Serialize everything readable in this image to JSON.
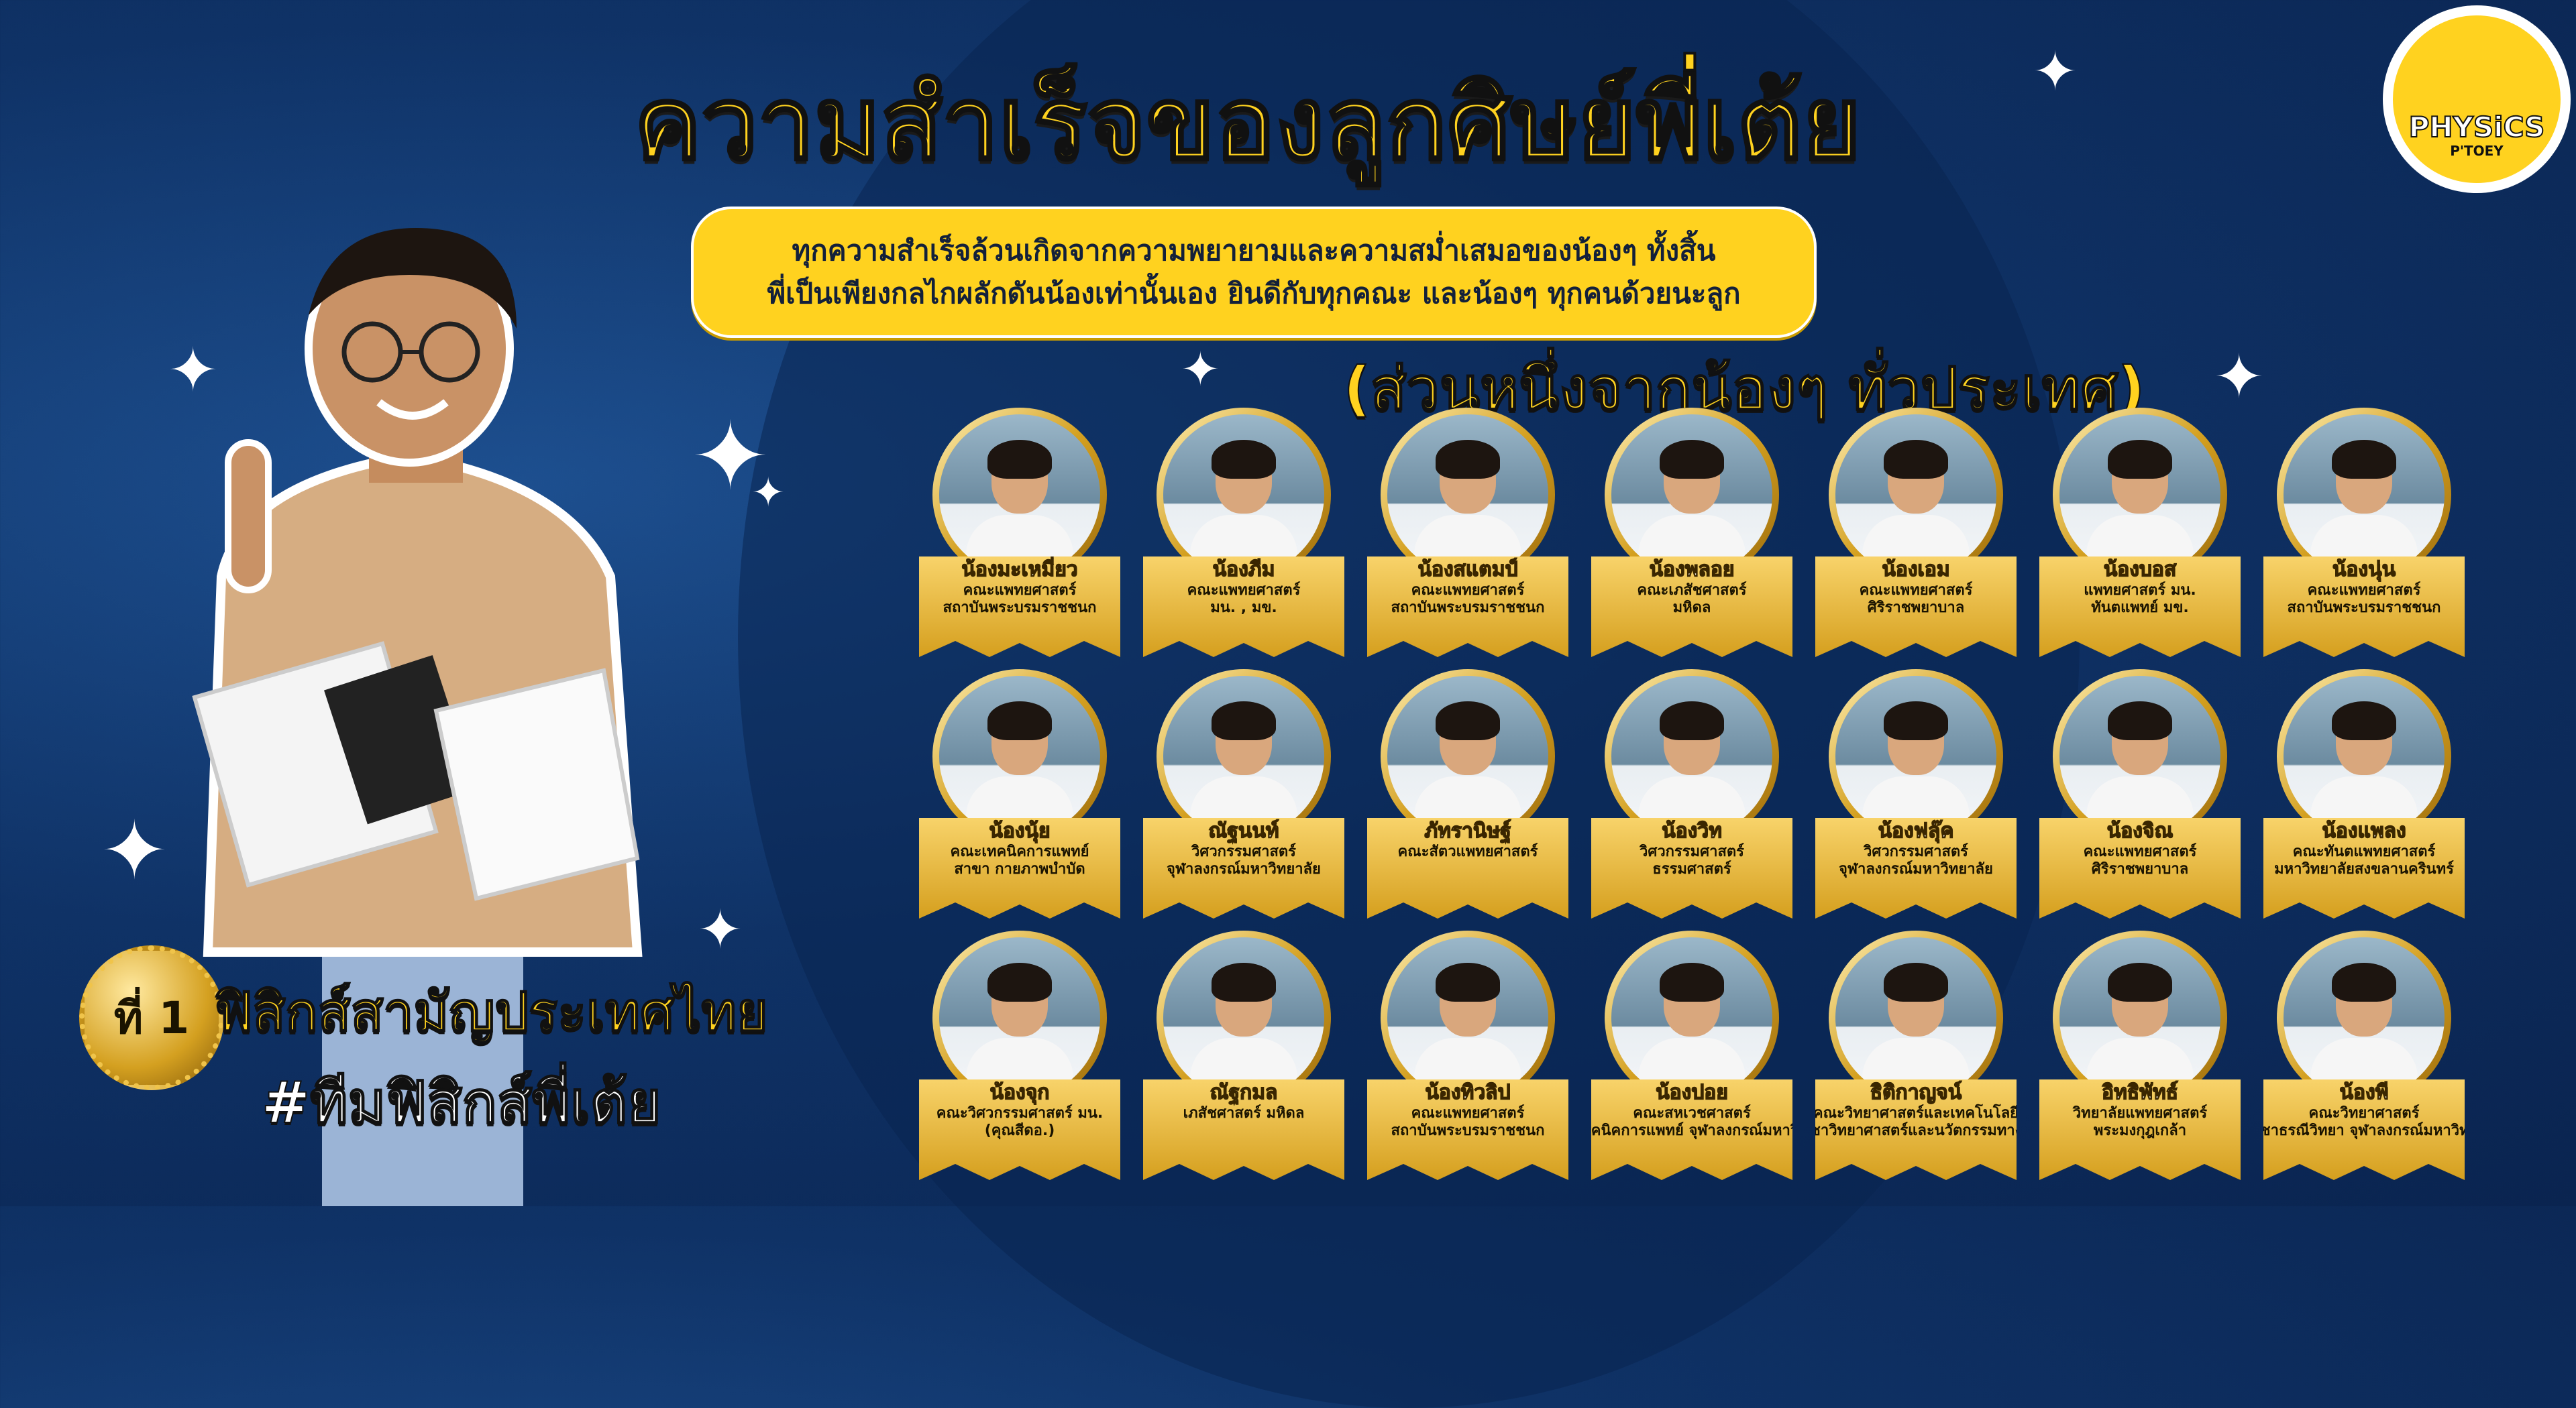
{
  "title": "ความสำเร็จของลูกศิษย์พี่เต้ย",
  "subtitle_line1": "ทุกความสำเร็จล้วนเกิดจากความพยายามและความสม่ำเสมอของน้องๆ ทั้งสิ้น",
  "subtitle_line2": "พี่เป็นเพียงกลไกผลักดันน้องเท่านั้นเอง ยินดีกับทุกคณะ และน้องๆ ทุกคนด้วยนะลูก",
  "section_title": "(ส่วนหนึ่งจากน้องๆ ทั่วประเทศ)",
  "badge": {
    "number": "ที่ 1",
    "text": "ฟิสิกส์สามัญประเทศไทย"
  },
  "hashtag": "#ทีมฟิสิกส์พี่เต้ย",
  "logo": {
    "main": "PHYSiCS",
    "sub": "P'TOEY"
  },
  "colors": {
    "background": "#0f3266",
    "accent": "#ffd21f",
    "gold": "#d4a020"
  },
  "students": [
    {
      "name": "น้องมะเหมี่ยว",
      "line1": "คณะแพทยศาสตร์",
      "line2": "สถาบันพระบรมราชชนก"
    },
    {
      "name": "น้องภีม",
      "line1": "คณะแพทยศาสตร์",
      "line2": "มน. , มข."
    },
    {
      "name": "น้องสแตมป์",
      "line1": "คณะแพทยศาสตร์",
      "line2": "สถาบันพระบรมราชชนก"
    },
    {
      "name": "น้องพลอย",
      "line1": "คณะเภสัชศาสตร์",
      "line2": "มหิดล"
    },
    {
      "name": "น้องเอม",
      "line1": "คณะแพทยศาสตร์",
      "line2": "ศิริราชพยาบาล"
    },
    {
      "name": "น้องบอส",
      "line1": "แพทยศาสตร์ มน.",
      "line2": "ทันตแพทย์ มข."
    },
    {
      "name": "น้องนุ่น",
      "line1": "คณะแพทยศาสตร์",
      "line2": "สถาบันพระบรมราชชนก"
    },
    {
      "name": "น้องนุ้ย",
      "line1": "คณะเทคนิคการแพทย์",
      "line2": "สาขา กายภาพบำบัด"
    },
    {
      "name": "ณัฐนนท์",
      "line1": "วิศวกรรมศาสตร์",
      "line2": "จุฬาลงกรณ์มหาวิทยาลัย"
    },
    {
      "name": "ภัทรานิษฐ์",
      "line1": "คณะสัตวแพทยศาสตร์",
      "line2": ""
    },
    {
      "name": "น้องวิท",
      "line1": "วิศวกรรมศาสตร์",
      "line2": "ธรรมศาสตร์"
    },
    {
      "name": "น้องฟลุ๊ค",
      "line1": "วิศวกรรมศาสตร์",
      "line2": "จุฬาลงกรณ์มหาวิทยาลัย"
    },
    {
      "name": "น้องจิณ",
      "line1": "คณะแพทยศาสตร์",
      "line2": "ศิริราชพยาบาล"
    },
    {
      "name": "น้องแพลง",
      "line1": "คณะทันตแพทยศาสตร์",
      "line2": "มหาวิทยาลัยสงขลานครินทร์"
    },
    {
      "name": "น้องจุก",
      "line1": "คณะวิศวกรรมศาสตร์ มน.",
      "line2": "(คุณสีดอ.)"
    },
    {
      "name": "ณัฐกมล",
      "line1": "เภสัชศาสตร์ มหิดล",
      "line2": ""
    },
    {
      "name": "น้องทิวลิป",
      "line1": "คณะแพทยศาสตร์",
      "line2": "สถาบันพระบรมราชชนก"
    },
    {
      "name": "น้องปอย",
      "line1": "คณะสหเวชศาสตร์",
      "line2": "สาขาเทคนิคการแพทย์ จุฬาลงกรณ์มหาวิทยาลัย"
    },
    {
      "name": "ธิติกาญจน์",
      "line1": "คณะวิทยาศาสตร์และเทคโนโลยี",
      "line2": "สาขาวิชาวิทยาศาสตร์และนวัตกรรมทางอาหาร"
    },
    {
      "name": "อิทธิพัทธ์",
      "line1": "วิทยาลัยแพทยศาสตร์",
      "line2": "พระมงกุฎเกล้า"
    },
    {
      "name": "น้องพี",
      "line1": "คณะวิทยาศาสตร์",
      "line2": "ภาควิชาธรณีวิทยา จุฬาลงกรณ์มหาวิทยาลัย"
    }
  ]
}
